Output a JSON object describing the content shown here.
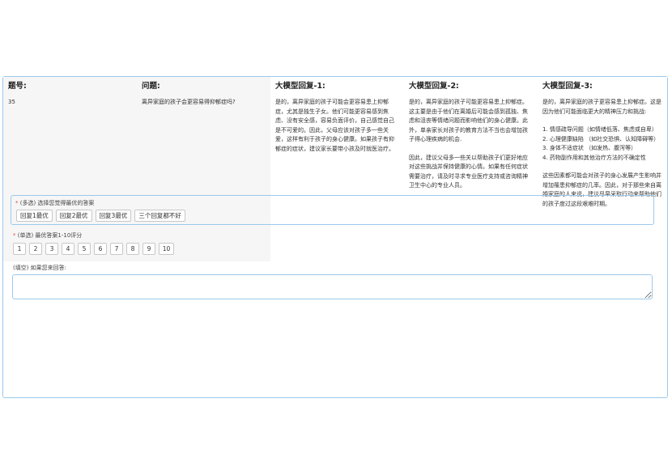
{
  "table": {
    "headers": [
      "题号:",
      "问题:",
      "大模型回复-1:",
      "大模型回复-2:",
      "大模型回复-3:"
    ],
    "id": "35",
    "question": "离异家庭的孩子会更容易得抑郁症吗?",
    "reply1": "是的，离异家庭的孩子可能会更容易患上抑郁症，尤其是独生子女。他们可能更容易感到焦虑、没有安全感，容易负面评价，自己感觉自己是不可爱的。因此，父母应该对孩子多一些关爱，这样有利于孩子的身心健康。如果孩子有抑郁症的症状，建议家长要带小孩及时就医治疗。",
    "reply2_p1": "是的，离异家庭的孩子可能更容易患上抑郁症。这主要是由于他们在离婚后可能会感到孤独、焦虑和沮丧等情绪问题而影响他们的身心健康。此外，单亲家长对孩子的教育方法不当也会增加孩子得心理疾病的机会.",
    "reply2_p2": "因此，建议父母多一些关以帮助孩子们更好地应对这些挑战并保持健康的心情。如果有任何症状需要治疗，请及时寻求专业医疗支持或咨询精神卫生中心的专业人员。",
    "reply3_p1": "是的，离异家庭的孩子更容易患上抑郁症。这是因为他们可能面临更大的精神压力和挑战:",
    "reply3_list": [
      "1. 情感疏导问题（如情绪低落、焦虑或自卑）",
      "2. 心理健康缺陷 （如社交恐惧、认知障碍等）",
      "3. 身体不适症状 （如发热、腹泻等）",
      "4. 药物副作用和其他治疗方法的不确定性"
    ],
    "reply3_p2": "这些因素都可能会对孩子的身心发展产生影响并增加罹患抑郁症的几率。因此，对于那些来自离婚家庭的人来说，建议尽早采取行动来帮助他们的孩子度过这段艰难时期。"
  },
  "q1": {
    "required_mark": "*",
    "label": " (多选) 选择您觉得最优的答案",
    "options": [
      "回复1最优",
      "回复2最优",
      "回复3最优",
      "三个回复都不好"
    ]
  },
  "q2": {
    "required_mark": "*",
    "label": " (单选) 最优答案1-10评分",
    "scores": [
      "1",
      "2",
      "3",
      "4",
      "5",
      "6",
      "7",
      "8",
      "9",
      "10"
    ]
  },
  "q3": {
    "label": "(填空) 如果您来回答:",
    "value": ""
  },
  "colors": {
    "border_accent": "#9cc9ec",
    "required": "#d9534f",
    "header_bg": "#f6f6f6"
  }
}
